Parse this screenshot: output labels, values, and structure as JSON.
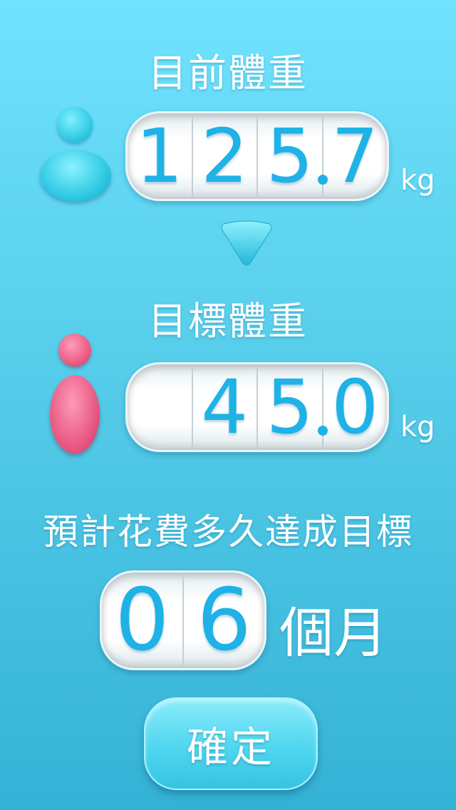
{
  "current_weight": {
    "label": "目前體重",
    "digits": [
      "1",
      "2",
      "5",
      "7"
    ],
    "unit": "kg"
  },
  "target_weight": {
    "label": "目標體重",
    "digits": [
      "",
      "4",
      "5",
      "0"
    ],
    "unit": "kg"
  },
  "duration": {
    "label": "預計花費多久達成目標",
    "digits": [
      "0",
      "6"
    ],
    "unit": "個月"
  },
  "confirm_label": "確定",
  "icons": {
    "current": "person-blue-icon",
    "target": "person-pink-icon",
    "arrow": "down-arrow-icon"
  },
  "colors": {
    "digit": "#1eb2e6",
    "blue_person": "#27c6e0",
    "pink_person": "#e8547e",
    "background_top": "#6fe2fe",
    "background_bottom": "#34b2d6"
  }
}
